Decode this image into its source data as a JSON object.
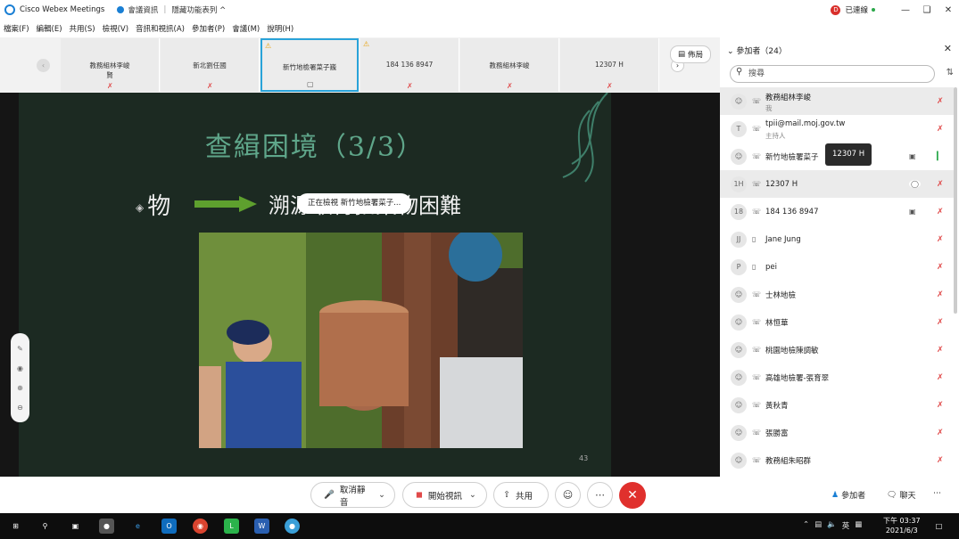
{
  "titlebar": {
    "app_name": "Cisco Webex Meetings",
    "meeting_info": "會議資訊",
    "hide_menu": "隱藏功能表列 ^",
    "badge": "D",
    "connected": "已連線"
  },
  "menu": [
    "檔案(F)",
    "編輯(E)",
    "共用(S)",
    "檢視(V)",
    "音訊和視訊(A)",
    "參加者(P)",
    "會議(M)",
    "說明(H)"
  ],
  "thumbnails": [
    {
      "name": "教務組林李峻\n賢",
      "warn": false,
      "active": false
    },
    {
      "name": "新北劉任國",
      "warn": false,
      "active": false
    },
    {
      "name": "新竹地檢署菜子巍",
      "warn": true,
      "active": true
    },
    {
      "name": "184 136 8947",
      "warn": true,
      "active": false
    },
    {
      "name": "教務組林李峻",
      "warn": false,
      "active": false
    },
    {
      "name": "12307 H",
      "warn": false,
      "active": false
    }
  ],
  "layout_label": "佈局",
  "viewing_banner": "正在檢視 新竹地檢署菜子...",
  "slide": {
    "title": "查緝困境（3/3）",
    "bullet": "物",
    "bullet_text": "溯源取得扣案物困難",
    "page": "43"
  },
  "toolbar": {
    "mute": "取消靜音",
    "video": "開始視訊",
    "share": "共用",
    "participants": "參加者",
    "chat": "聊天"
  },
  "panel": {
    "title": "參加者（24）",
    "search_placeholder": "搜尋",
    "participants": [
      {
        "avatar": "",
        "name": "教務組林李峻",
        "sub": "我",
        "device": "phone",
        "cam": false,
        "mic": "off",
        "selected": true
      },
      {
        "avatar": "T",
        "name": "tpii@mail.moj.gov.tw",
        "sub": "主持人",
        "device": "phone",
        "cam": false,
        "mic": "off",
        "selected": false
      },
      {
        "avatar": "",
        "name": "新竹地檢署菜子",
        "sub": "",
        "device": "phone",
        "cam": true,
        "mic": "on",
        "selected": false
      },
      {
        "avatar": "1H",
        "name": "12307 H",
        "sub": "",
        "device": "phone",
        "cam": false,
        "mic": "off",
        "selected": true,
        "chat": true
      },
      {
        "avatar": "18",
        "name": "184 136 8947",
        "sub": "",
        "device": "phone",
        "cam": true,
        "mic": "off",
        "selected": false
      },
      {
        "avatar": "JJ",
        "name": "Jane Jung",
        "sub": "",
        "device": "mobile",
        "cam": false,
        "mic": "off",
        "selected": false
      },
      {
        "avatar": "P",
        "name": "pei",
        "sub": "",
        "device": "mobile",
        "cam": false,
        "mic": "off",
        "selected": false
      },
      {
        "avatar": "",
        "name": "士林地檢",
        "sub": "",
        "device": "phone",
        "cam": false,
        "mic": "off",
        "selected": false
      },
      {
        "avatar": "",
        "name": "林恒華",
        "sub": "",
        "device": "phone",
        "cam": false,
        "mic": "off",
        "selected": false
      },
      {
        "avatar": "",
        "name": "桃園地檢陳調敏",
        "sub": "",
        "device": "phone",
        "cam": false,
        "mic": "off",
        "selected": false
      },
      {
        "avatar": "",
        "name": "高雄地檢署-張育翠",
        "sub": "",
        "device": "phone",
        "cam": false,
        "mic": "off",
        "selected": false
      },
      {
        "avatar": "",
        "name": "黃秋青",
        "sub": "",
        "device": "phone",
        "cam": false,
        "mic": "off",
        "selected": false
      },
      {
        "avatar": "",
        "name": "張勝富",
        "sub": "",
        "device": "phone",
        "cam": false,
        "mic": "off",
        "selected": false
      },
      {
        "avatar": "",
        "name": "教務組朱昭群",
        "sub": "",
        "device": "phone",
        "cam": false,
        "mic": "off",
        "selected": false
      }
    ],
    "tooltip": "12307 H"
  },
  "taskbar": {
    "time": "下午 03:37",
    "date": "2021/6/3",
    "ime": "英"
  },
  "colors": {
    "accent": "#29a3d9",
    "end": "#e0302d",
    "muted": "#e04a4a",
    "unmuted": "#2ba84a"
  }
}
